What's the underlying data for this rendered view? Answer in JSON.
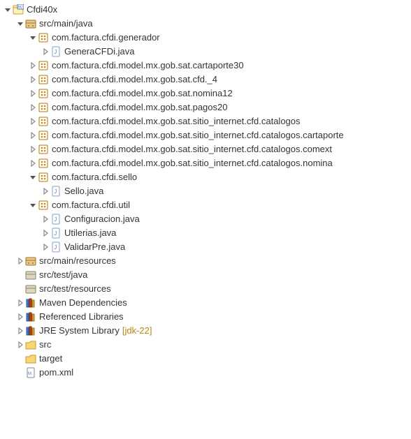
{
  "project": {
    "name": "Cfdi40x"
  },
  "src_main_java": {
    "label": "src/main/java",
    "packages": {
      "generador": {
        "label": "com.factura.cfdi.generador",
        "files": [
          "GeneraCFDi.java"
        ]
      },
      "cartaporte30": "com.factura.cfdi.model.mx.gob.sat.cartaporte30",
      "cfd4": "com.factura.cfdi.model.mx.gob.sat.cfd._4",
      "nomina12": "com.factura.cfdi.model.mx.gob.sat.nomina12",
      "pagos20": "com.factura.cfdi.model.mx.gob.sat.pagos20",
      "catalogos": "com.factura.cfdi.model.mx.gob.sat.sitio_internet.cfd.catalogos",
      "catalogos_cartaporte": "com.factura.cfdi.model.mx.gob.sat.sitio_internet.cfd.catalogos.cartaporte",
      "catalogos_comext": "com.factura.cfdi.model.mx.gob.sat.sitio_internet.cfd.catalogos.comext",
      "catalogos_nomina": "com.factura.cfdi.model.mx.gob.sat.sitio_internet.cfd.catalogos.nomina",
      "sello": {
        "label": "com.factura.cfdi.sello",
        "files": [
          "Sello.java"
        ]
      },
      "util": {
        "label": "com.factura.cfdi.util",
        "files": [
          "Configuracion.java",
          "Utilerias.java",
          "ValidarPre.java"
        ]
      }
    }
  },
  "src_main_resources": "src/main/resources",
  "src_test_java": "src/test/java",
  "src_test_resources": "src/test/resources",
  "maven_deps": "Maven Dependencies",
  "ref_libs": "Referenced Libraries",
  "jre": {
    "label": "JRE System Library",
    "deco": "[jdk-22]"
  },
  "src_folder": "src",
  "target_folder": "target",
  "pom": "pom.xml"
}
